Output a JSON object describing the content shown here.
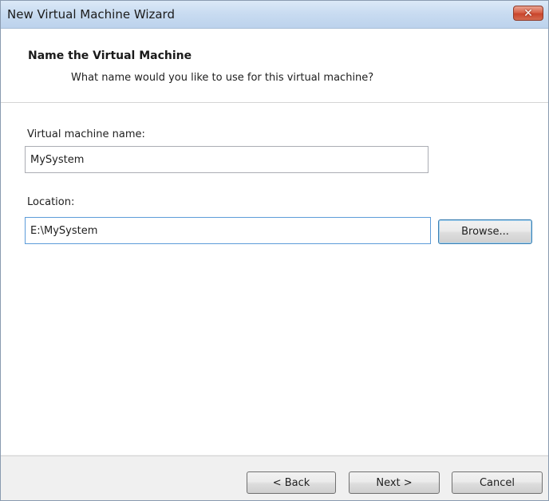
{
  "window": {
    "title": "New Virtual Machine Wizard",
    "close_glyph": "✕"
  },
  "header": {
    "title": "Name the Virtual Machine",
    "subtitle": "What name would you like to use for this virtual machine?"
  },
  "form": {
    "name_label": "Virtual machine name:",
    "name_value": "MySystem",
    "location_label": "Location:",
    "location_value": "E:\\MySystem",
    "browse_label": "Browse..."
  },
  "footer": {
    "back_label": "< Back",
    "next_label": "Next >",
    "cancel_label": "Cancel"
  }
}
